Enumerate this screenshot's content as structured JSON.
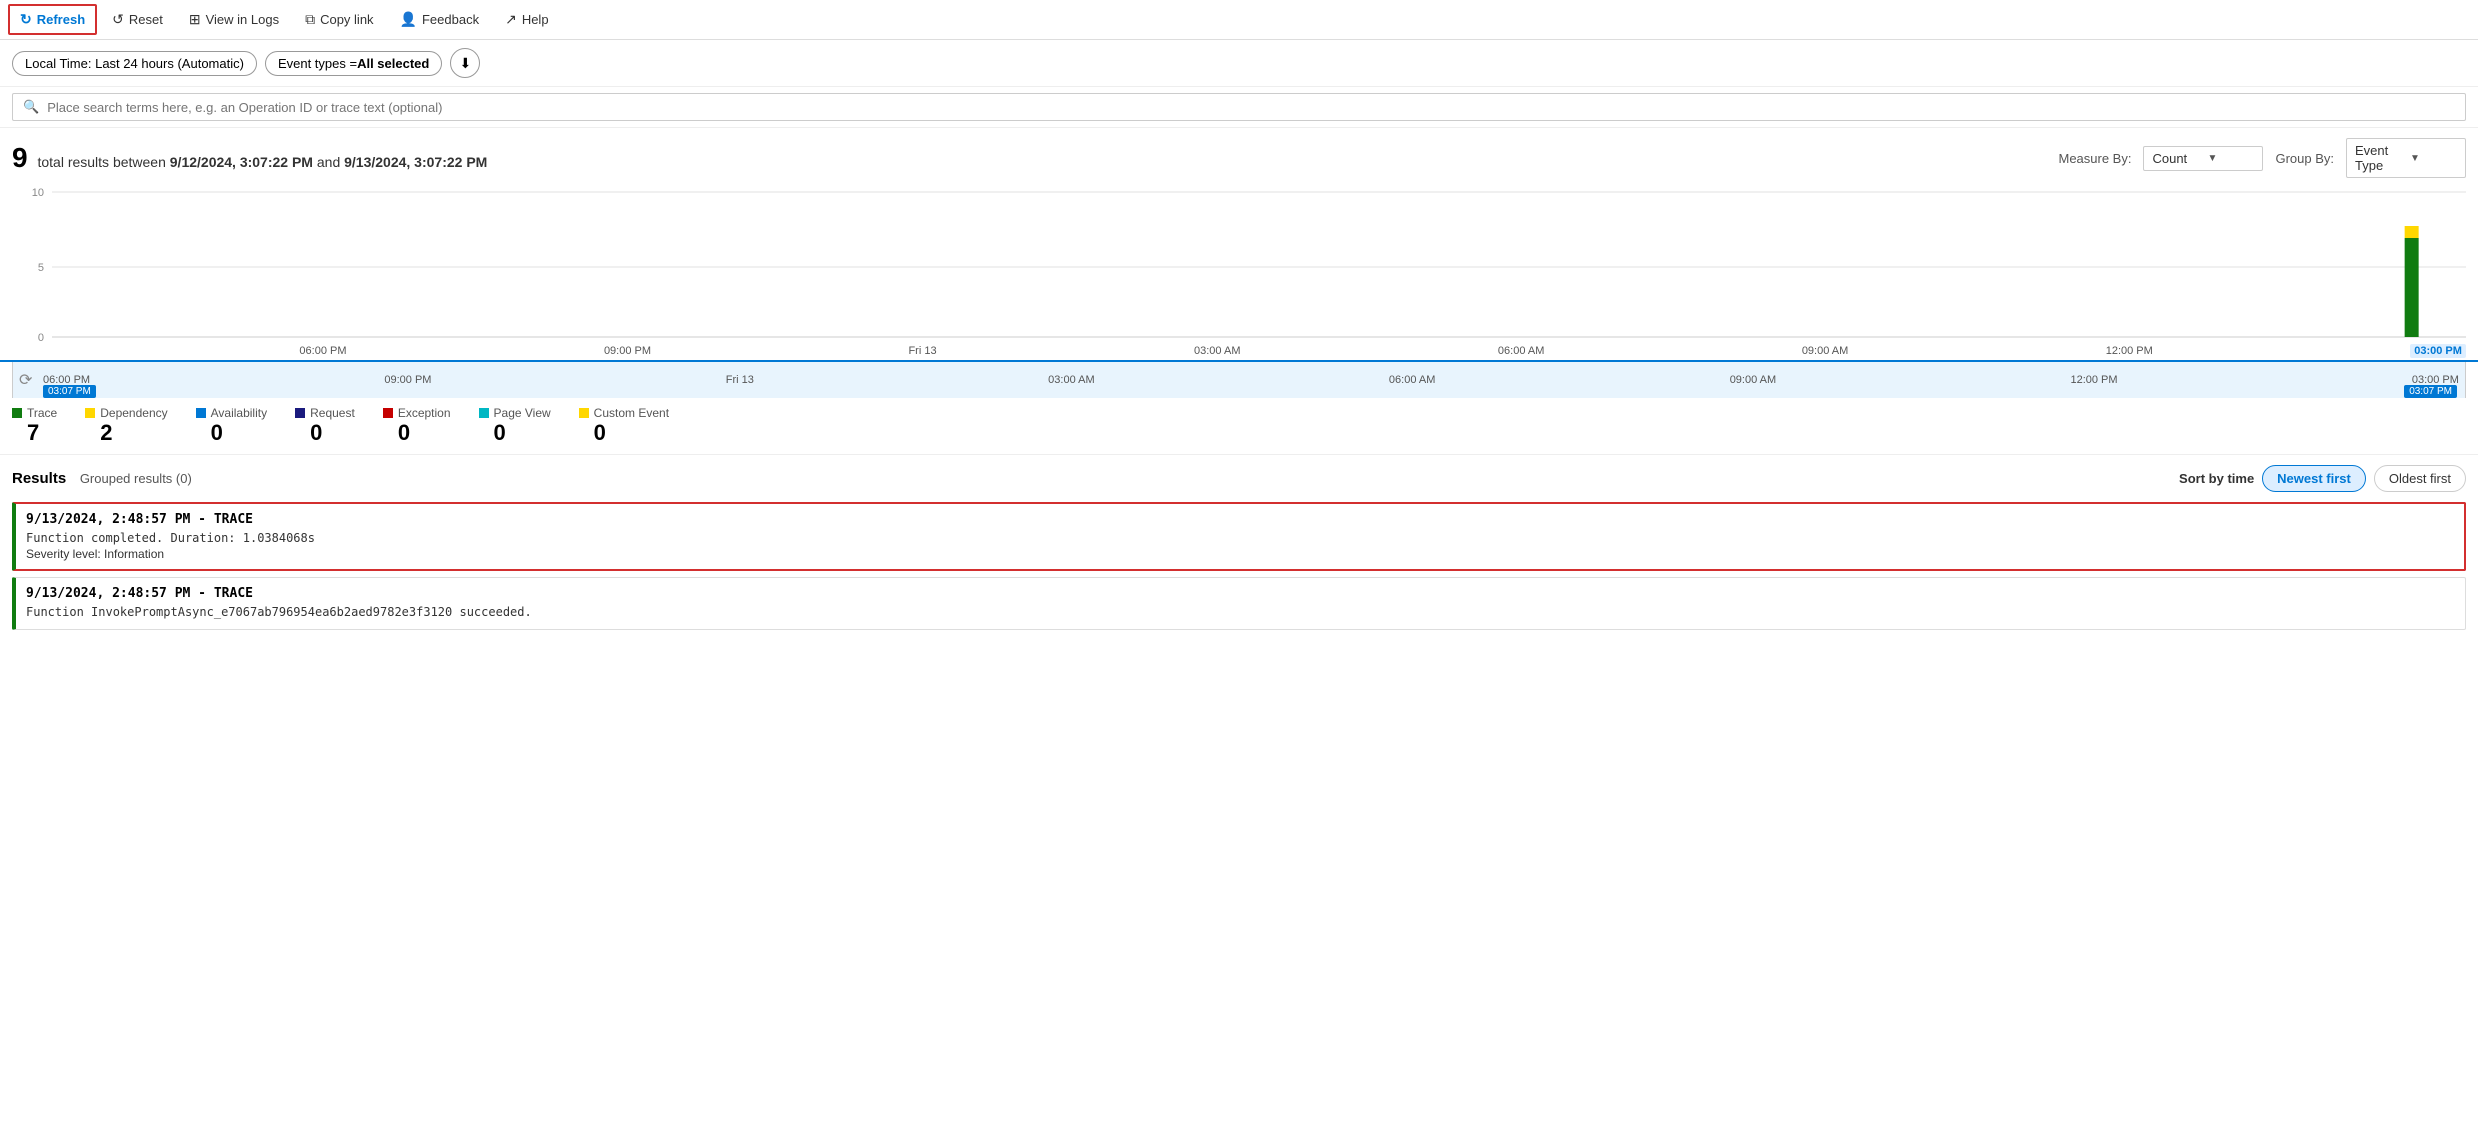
{
  "toolbar": {
    "refresh_label": "Refresh",
    "reset_label": "Reset",
    "view_in_logs_label": "View in Logs",
    "copy_link_label": "Copy link",
    "feedback_label": "Feedback",
    "help_label": "Help"
  },
  "filter_bar": {
    "time_filter_label": "Local Time: Last 24 hours (Automatic)",
    "event_types_label": "Event types = ",
    "event_types_value": "All selected"
  },
  "search": {
    "placeholder": "Place search terms here, e.g. an Operation ID or trace text (optional)"
  },
  "results_summary": {
    "count": "9",
    "text": "total results between",
    "start_time": "9/12/2024, 3:07:22 PM",
    "and": "and",
    "end_time": "9/13/2024, 3:07:22 PM"
  },
  "measure": {
    "label": "Measure By:",
    "value": "Count",
    "group_label": "Group By:",
    "group_value": "Event Type"
  },
  "chart": {
    "y_labels": [
      "10",
      "5",
      "0"
    ],
    "x_labels": [
      "06:00 PM",
      "09:00 PM",
      "Fri 13",
      "03:00 AM",
      "06:00 AM",
      "09:00 AM",
      "12:00 PM",
      "03:00 PM"
    ],
    "mini_x_labels": [
      "06:00 PM",
      "09:00 PM",
      "Fri 13",
      "03:00 AM",
      "06:00 AM",
      "09:00 AM",
      "12:00 PM",
      "03:00 PM"
    ],
    "time_left": "03:07 PM",
    "time_right": "03:07 PM",
    "bar_trace_height_pct": 70,
    "bar_custom_height_pct": 10
  },
  "legend": {
    "items": [
      {
        "label": "Trace",
        "color": "#107c10",
        "count": "7"
      },
      {
        "label": "Dependency",
        "color": "#ffd700",
        "count": "2"
      },
      {
        "label": "Availability",
        "color": "#0078d4",
        "count": "0"
      },
      {
        "label": "Request",
        "color": "#1a1a7e",
        "count": "0"
      },
      {
        "label": "Exception",
        "color": "#c50000",
        "count": "0"
      },
      {
        "label": "Page View",
        "color": "#00b7c3",
        "count": "0"
      },
      {
        "label": "Custom Event",
        "color": "#ffd700",
        "count": "0"
      }
    ]
  },
  "results_section": {
    "title": "Results",
    "grouped_label": "Grouped results (0)",
    "sort_label": "Sort by time",
    "sort_options": [
      "Newest first",
      "Oldest first"
    ],
    "active_sort": "Newest first"
  },
  "result_items": [
    {
      "timestamp": "9/13/2024, 2:48:57 PM",
      "type": "TRACE",
      "message": "Function completed. Duration: 1.0384068s",
      "severity": "Severity level: Information",
      "selected": true,
      "color": "#107c10"
    },
    {
      "timestamp": "9/13/2024, 2:48:57 PM",
      "type": "TRACE",
      "message": "Function InvokePromptAsync_e7067ab796954ea6b2aed9782e3f3120 succeeded.",
      "severity": "",
      "selected": false,
      "color": "#107c10"
    }
  ]
}
